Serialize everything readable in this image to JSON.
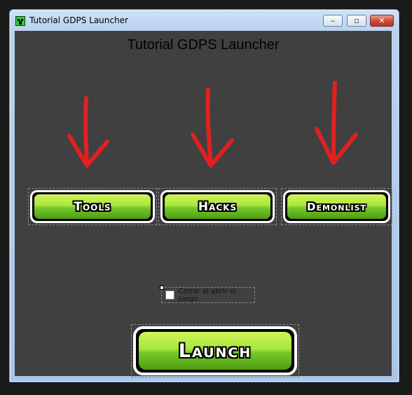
{
  "window": {
    "title": "Tutorial GDPS Launcher"
  },
  "titlebar_buttons": {
    "minimize": "‒",
    "maximize": "▫",
    "close": "✕"
  },
  "main": {
    "heading": "Tutorial GDPS Launcher",
    "buttons": [
      {
        "label": "Tools"
      },
      {
        "label": "Hacks"
      },
      {
        "label": "Demonlist"
      }
    ],
    "checkbox": {
      "label": "Cerrar al abrir el juego",
      "checked": false
    },
    "launch": {
      "label": "Launch"
    }
  },
  "colors": {
    "accent_arrow": "#e0211f",
    "button_green": "#8fd836",
    "background": "#404040"
  },
  "icons": [
    "creeper-icon",
    "minimize-icon",
    "maximize-icon",
    "close-icon",
    "red-arrow-icon"
  ]
}
